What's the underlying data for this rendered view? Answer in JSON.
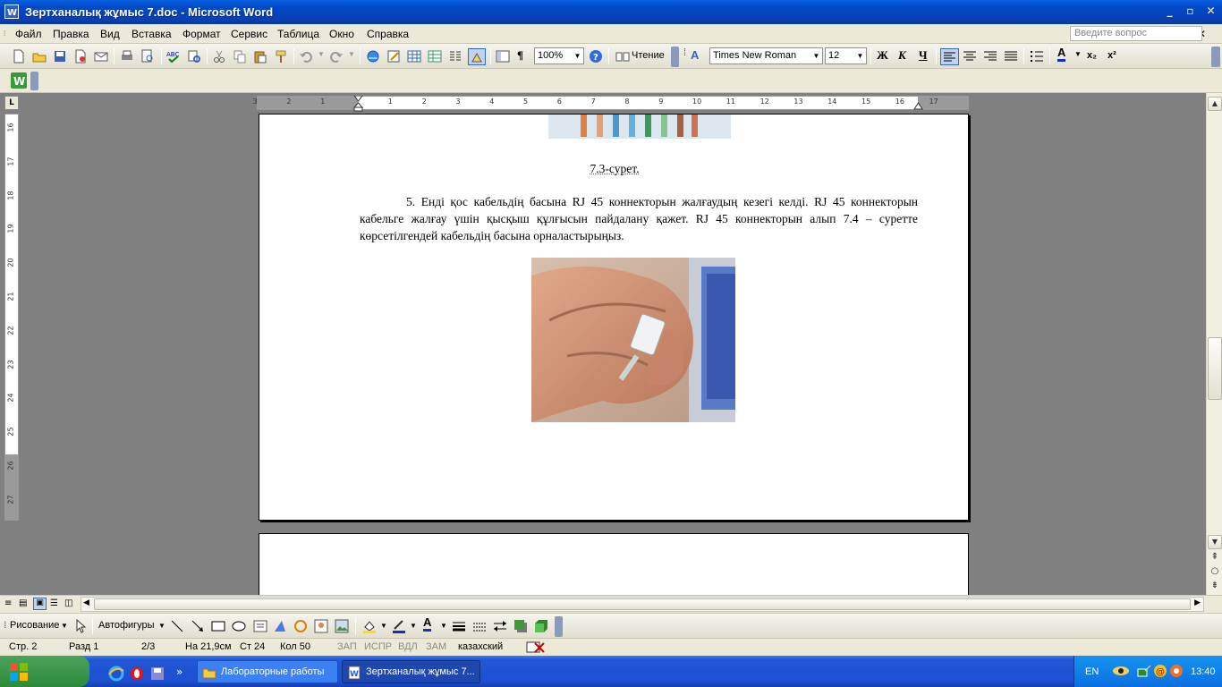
{
  "window": {
    "title": "Зертханалық жұмыс 7.doc - Microsoft Word"
  },
  "menu": {
    "items": [
      "Файл",
      "Правка",
      "Вид",
      "Вставка",
      "Формат",
      "Сервис",
      "Таблица",
      "Окно",
      "Справка"
    ],
    "question_placeholder": "Введите вопрос"
  },
  "toolbar": {
    "zoom": "100%",
    "reading_label": "Чтение",
    "font_name": "Times New Roman",
    "font_size": "12",
    "bold": "Ж",
    "italic": "К",
    "underline": "Ч",
    "superscript": "x²",
    "subscript": "x₂",
    "pilcrow": "¶",
    "font_color_glyph": "A"
  },
  "ruler": {
    "horizontal_ticks": [
      "3",
      "2",
      "1",
      "1",
      "2",
      "3",
      "4",
      "5",
      "6",
      "7",
      "8",
      "9",
      "10",
      "11",
      "12",
      "13",
      "14",
      "15",
      "16",
      "17"
    ],
    "vertical_ticks": [
      "16",
      "17",
      "18",
      "19",
      "20",
      "21",
      "22",
      "23",
      "24",
      "25",
      "26",
      "27"
    ],
    "corner_glyph": "L"
  },
  "document": {
    "caption": "7.3-сурет.",
    "paragraph": "5. Енді қос кабельдің басына RJ 45 коннекторын жалғаудың кезегі келді. RJ 45 коннекторын кабельге жалғау үшін қысқыш құлғысын пайдалану қажет. RJ 45 коннекторын алып 7.4 – суретте көрсетілгендей кабельдің басына орналастырыңыз."
  },
  "drawing": {
    "draw_label": "Рисование",
    "autoshapes_label": "Автофигуры"
  },
  "status": {
    "page": "Стр. 2",
    "section": "Разд 1",
    "pages": "2/3",
    "at": "На 21,9см",
    "line": "Ст 24",
    "col": "Кол 50",
    "rec": "ЗАП",
    "trk": "ИСПР",
    "ext": "ВДЛ",
    "ovr": "ЗАМ",
    "language": "казахский"
  },
  "taskbar": {
    "buttons": [
      {
        "label": "Лабораторные работы"
      },
      {
        "label": "Зертханалық жұмыс 7..."
      }
    ],
    "lang": "EN",
    "clock": "13:40"
  },
  "colors": {
    "title_blue": "#0a4fd0",
    "taskbar_blue": "#245edb",
    "start_green": "#3c9a4a"
  }
}
